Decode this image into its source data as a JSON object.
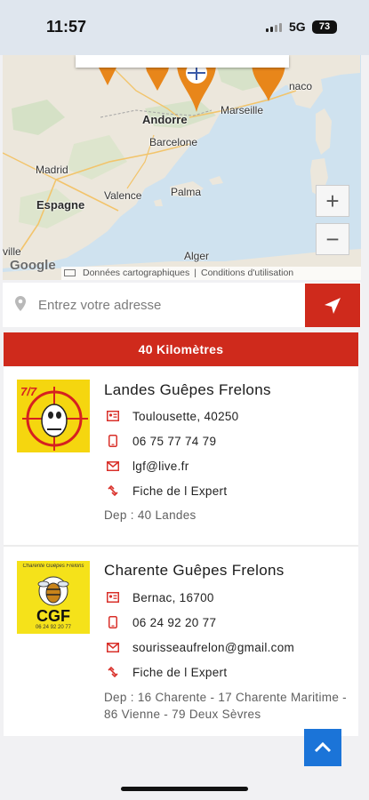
{
  "status_bar": {
    "time": "11:57",
    "network": "5G",
    "battery": "73"
  },
  "map": {
    "labels": {
      "andorre": "Andorre",
      "marseille": "Marseille",
      "monaco": "naco",
      "madrid": "Madrid",
      "espagne": "Espagne",
      "barcelone": "Barcelone",
      "valence": "Valence",
      "palma": "Palma",
      "alger": "Alger",
      "ville": "ville"
    },
    "google": "Google",
    "attribution": {
      "map_data": "Données cartographiques",
      "terms": "Conditions d'utilisation"
    },
    "zoom_in": "+",
    "zoom_out": "−"
  },
  "search": {
    "placeholder": "Entrez votre adresse",
    "value": ""
  },
  "radius": {
    "label": "40 Kilomètres"
  },
  "experts": [
    {
      "name": "Landes Guêpes Frelons",
      "location": "Toulousette, 40250",
      "phone": "06 75 77 74 79",
      "email": "lgf@live.fr",
      "link": "Fiche de l Expert",
      "dep": "Dep : 40 Landes",
      "logo_text": "7/7"
    },
    {
      "name": "Charente Guêpes Frelons",
      "location": "Bernac, 16700",
      "phone": "06 24 92 20 77",
      "email": "sourisseaufrelon@gmail.com",
      "link": "Fiche de l Expert",
      "dep": "Dep : 16 Charente - 17 Charente Maritime - 86 Vienne - 79 Deux Sèvres",
      "logo_text": "CGF",
      "logo_top": "Charente Guêpes Frelons",
      "logo_phone": "06 24 92 20 77"
    }
  ],
  "colors": {
    "accent_red": "#cf2a1c",
    "scroll_button_blue": "#1b74d8",
    "marker_orange": "#e8861a"
  }
}
